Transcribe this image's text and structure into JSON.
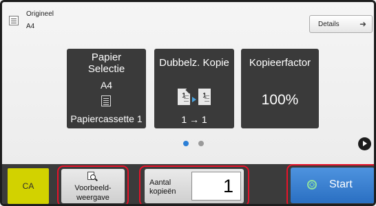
{
  "original": {
    "label": "Origineel",
    "size": "A4",
    "details_label": "Details",
    "icons": [
      "document-icon",
      "arrow-right-icon"
    ]
  },
  "tiles": {
    "paper": {
      "title_line1": "Papier",
      "title_line2": "Selectie",
      "size": "A4",
      "tray": "Papiercassette 1"
    },
    "duplex": {
      "title": "Dubbelz. Kopie",
      "page1": "1",
      "page2": "1",
      "mode": "1 → 1"
    },
    "zoom": {
      "title": "Kopieerfactor",
      "value": "100%"
    }
  },
  "pagination": {
    "current_page": 1,
    "total_pages": 2
  },
  "bottom": {
    "ca_label": "CA",
    "preview_line1": "Voorbeeld-",
    "preview_line2": "weergave",
    "copies_line1": "Aantal",
    "copies_line2": "kopieën",
    "copies_value": "1",
    "start_label": "Start"
  },
  "colors": {
    "tile_bg": "#3a3a3a",
    "ca_bg": "#d2d200",
    "start_bg": "#2f77cc",
    "highlight": "#e8122a",
    "page_dot_active": "#2c7fd6"
  }
}
